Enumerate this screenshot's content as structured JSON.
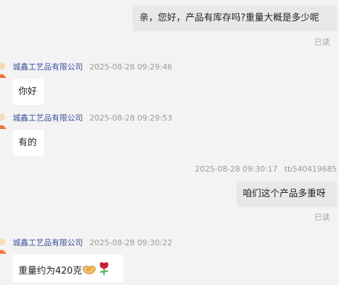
{
  "chat": {
    "messages": [
      {
        "direction": "outgoing",
        "text": "亲，您好，产品有库存吗?重量大概是多少呢",
        "status": "已读"
      },
      {
        "direction": "incoming",
        "sender": "城鑫工艺品有限公司",
        "time": "2025-08-28 09:29:46",
        "text": "你好"
      },
      {
        "direction": "incoming",
        "sender": "城鑫工艺品有限公司",
        "time": "2025-08-28 09:29:53",
        "text": "有的"
      },
      {
        "direction": "outgoing",
        "time": "2025-08-28 09:30:17",
        "sender": "tb540419685",
        "text": "咱们这个产品多重呀",
        "status": "已读"
      },
      {
        "direction": "incoming",
        "sender": "城鑫工艺品有限公司",
        "time": "2025-08-28 09:30:22",
        "text": "重量约为420克",
        "emojis": [
          "handshake-emoji",
          "rose-emoji"
        ]
      }
    ]
  },
  "colors": {
    "background": "#f3f3f3",
    "outgoing_bubble": "#e8e8e8",
    "incoming_bubble": "#ffffff",
    "sender_name": "#3b4f9c",
    "meta_text": "#9a9a9a"
  }
}
